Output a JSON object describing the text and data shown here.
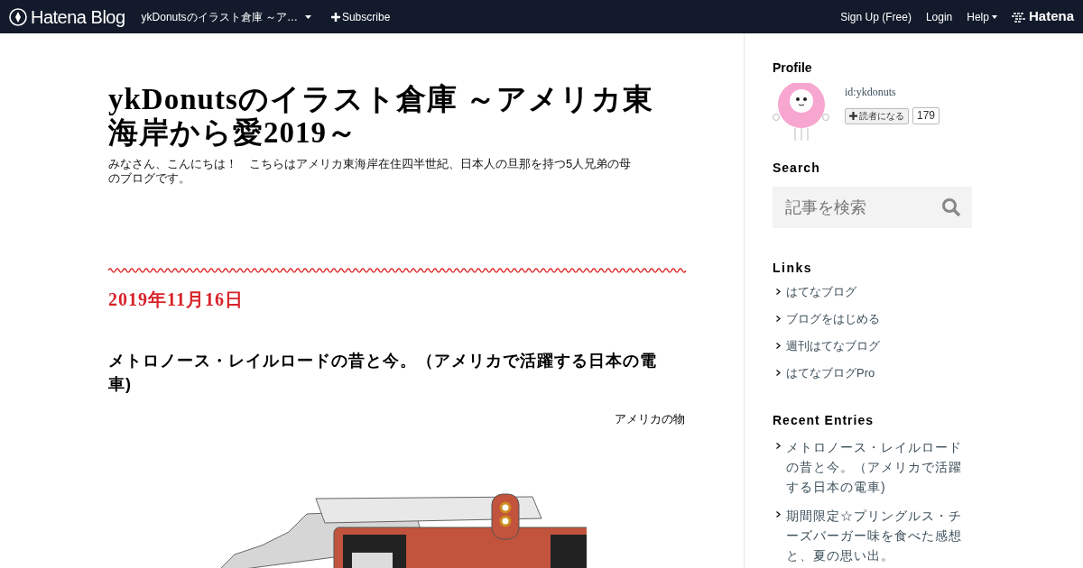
{
  "topbar": {
    "brand": "Hatena Blog",
    "blog_menu": "ykDonutsのイラスト倉庫 ～ア…",
    "subscribe": "Subscribe",
    "links": [
      {
        "label": "Sign Up (Free)",
        "kind": "link"
      },
      {
        "label": "Login",
        "kind": "link"
      },
      {
        "label": "Help",
        "kind": "menu"
      }
    ],
    "hatena": "Hatena"
  },
  "blog": {
    "title": "ykDonutsのイラスト倉庫 ～アメリカ東海岸から愛2019～",
    "description": "みなさん、こんにちは！　こちらはアメリカ東海岸在住四半世紀、日本人の旦那を持つ5人兄弟の母のブログです。"
  },
  "entry": {
    "date": "2019年11月16日",
    "title": "メトロノース・レイルロードの昔と今。（アメリカで活躍する日本の電車)",
    "category": "アメリカの物"
  },
  "sidebar": {
    "profile": {
      "heading": "Profile",
      "id": "id:ykdonuts",
      "subscribe": "読者になる",
      "count": "179"
    },
    "search": {
      "heading": "Search",
      "placeholder": "記事を検索"
    },
    "links": {
      "heading": "Links",
      "items": [
        "はてなブログ",
        "ブログをはじめる",
        "週刊はてなブログ",
        "はてなブログPro"
      ]
    },
    "recent": {
      "heading": "Recent Entries",
      "items": [
        "メトロノース・レイルロードの昔と今。（アメリカで活躍する日本の電車)",
        "期間限定☆プリングルス・チーズバーガー味を食べた感想と、夏の思い出。"
      ]
    }
  }
}
